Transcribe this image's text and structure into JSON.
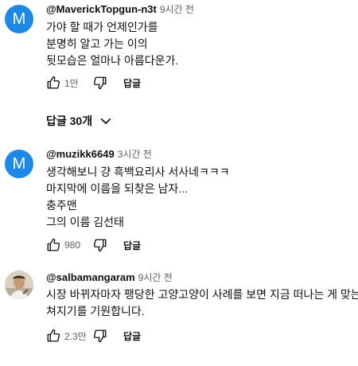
{
  "comments": [
    {
      "handle": "@MaverickTopgun-n3t",
      "time": "9시간 전",
      "avatar_letter": "M",
      "lines": [
        "가야 할 때가 언제인가를",
        "분명히 알고 가는 이의",
        "뒷모습은 얼마나 아름다운가."
      ],
      "likes": "1만",
      "reply_label": "답글",
      "replies_toggle": "답글 30개"
    },
    {
      "handle": "@muzikk6649",
      "time": "3시간 전",
      "avatar_letter": "M",
      "lines": [
        "생각해보니 걍 흑백요리사 서사네ㅋㅋㅋ",
        "마지막에 이름을 되찾은 남자...",
        "충주맨",
        "그의 이름 김선태"
      ],
      "likes": "980",
      "reply_label": "답글"
    },
    {
      "handle": "@salbamangaram",
      "time": "9시간 전",
      "lines": [
        "시장 바뀌자마자 팽당한 고양고양이 사례를 보면 지금 떠나는 게 맞는",
        "쳐지기를 기원합니다."
      ],
      "likes": "2.3만",
      "reply_label": "답글"
    }
  ],
  "colors": {
    "avatar_blue": "#1e88e5",
    "text_primary": "#0f0f0f",
    "text_secondary": "#606060"
  },
  "icons": [
    "thumbs-up-icon",
    "thumbs-down-icon",
    "chevron-down-icon"
  ]
}
